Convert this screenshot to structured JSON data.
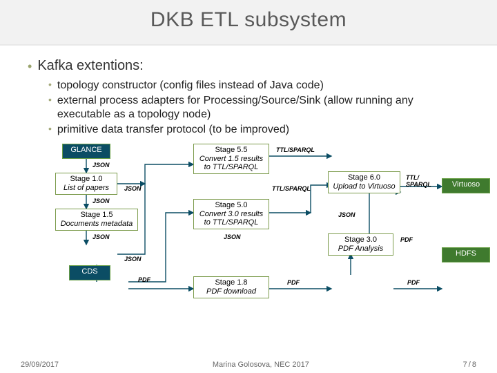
{
  "title": "DKB ETL subsystem",
  "bullets": {
    "l1": "Kafka extentions:",
    "sub": [
      "topology constructor (config files instead of Java code)",
      "external process adapters for Processing/Source/Sink (allow running any executable as a topology node)",
      "primitive data transfer protocol (to be improved)"
    ]
  },
  "boxes": {
    "glance": {
      "t1": "GLANCE"
    },
    "s10": {
      "t1": "Stage 1.0",
      "t2": "List of papers"
    },
    "s15": {
      "t1": "Stage 1.5",
      "t2": "Documents metadata"
    },
    "cds": {
      "t1": "CDS"
    },
    "s55": {
      "t1": "Stage 5.5",
      "t2": "Convert 1.5 results to TTL/SPARQL"
    },
    "s50": {
      "t1": "Stage 5.0",
      "t2": "Convert 3.0 results to TTL/SPARQL"
    },
    "s18": {
      "t1": "Stage 1.8",
      "t2": "PDF download"
    },
    "s60": {
      "t1": "Stage 6.0",
      "t2": "Upload to Virtuoso"
    },
    "s30": {
      "t1": "Stage 3.0",
      "t2": "PDF Analysis"
    },
    "virtuoso": {
      "t1": "Virtuoso"
    },
    "hdfs": {
      "t1": "HDFS"
    }
  },
  "labels": {
    "json": "JSON",
    "pdf": "PDF",
    "ttl": "TTL/SPARQL",
    "ttl2": "TTL/ SPARQL"
  },
  "footer": {
    "date": "29/09/2017",
    "author": "Marina Golosova, NEC 2017",
    "page_cur": "7",
    "page_sep": "/",
    "page_tot": "8"
  }
}
